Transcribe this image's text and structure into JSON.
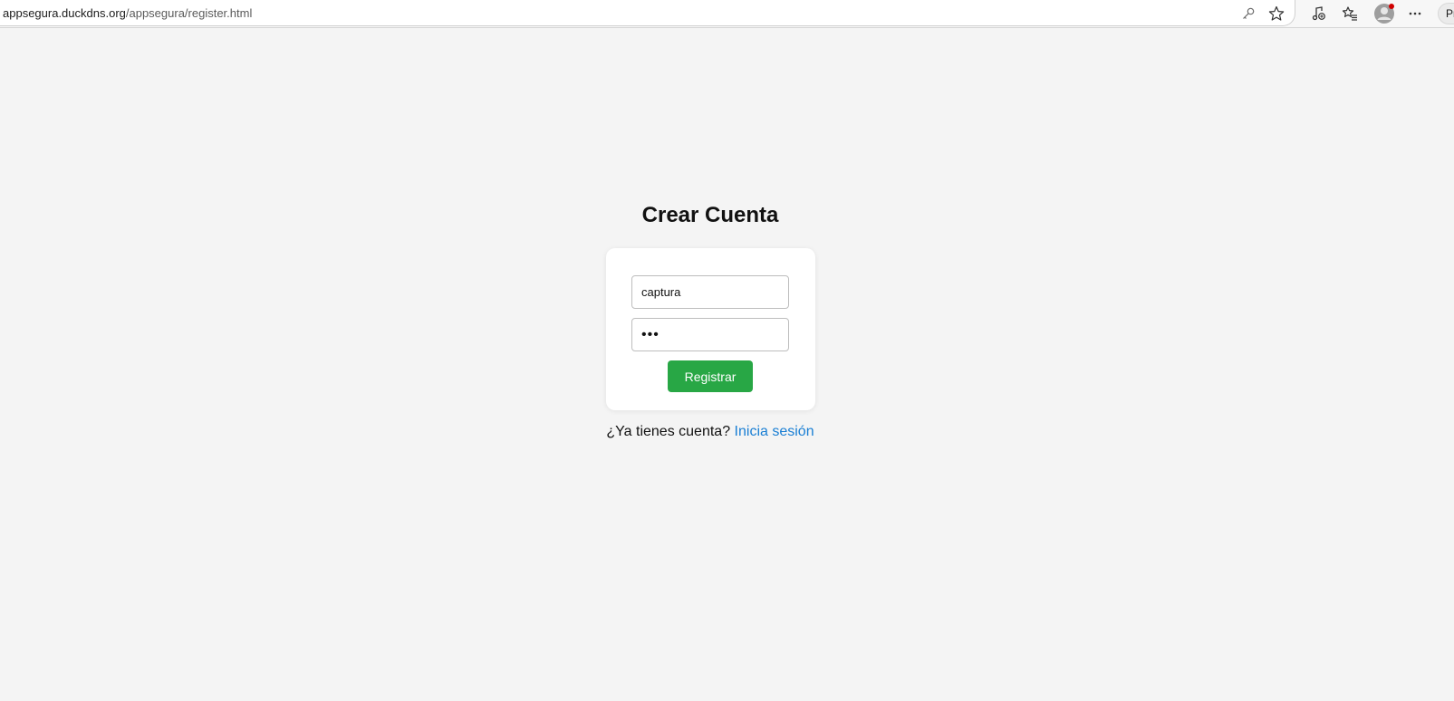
{
  "browser": {
    "url_host": "appsegura.duckdns.org",
    "url_path": "/appsegura/register.html",
    "profile_label": "Pr",
    "icons": [
      "key-icon",
      "star-icon",
      "music-icon",
      "favorites-icon",
      "profile-avatar-icon",
      "more-icon"
    ],
    "notification_color": "#d00000"
  },
  "page": {
    "title": "Crear Cuenta",
    "username_value": "captura",
    "password_value": "•••",
    "submit_label": "Registrar",
    "footer_text": "¿Ya tienes cuenta?",
    "login_link_label": "Inicia sesión"
  },
  "colors": {
    "background": "#f4f4f4",
    "button": "#28a745",
    "link": "#1a7fd4"
  }
}
